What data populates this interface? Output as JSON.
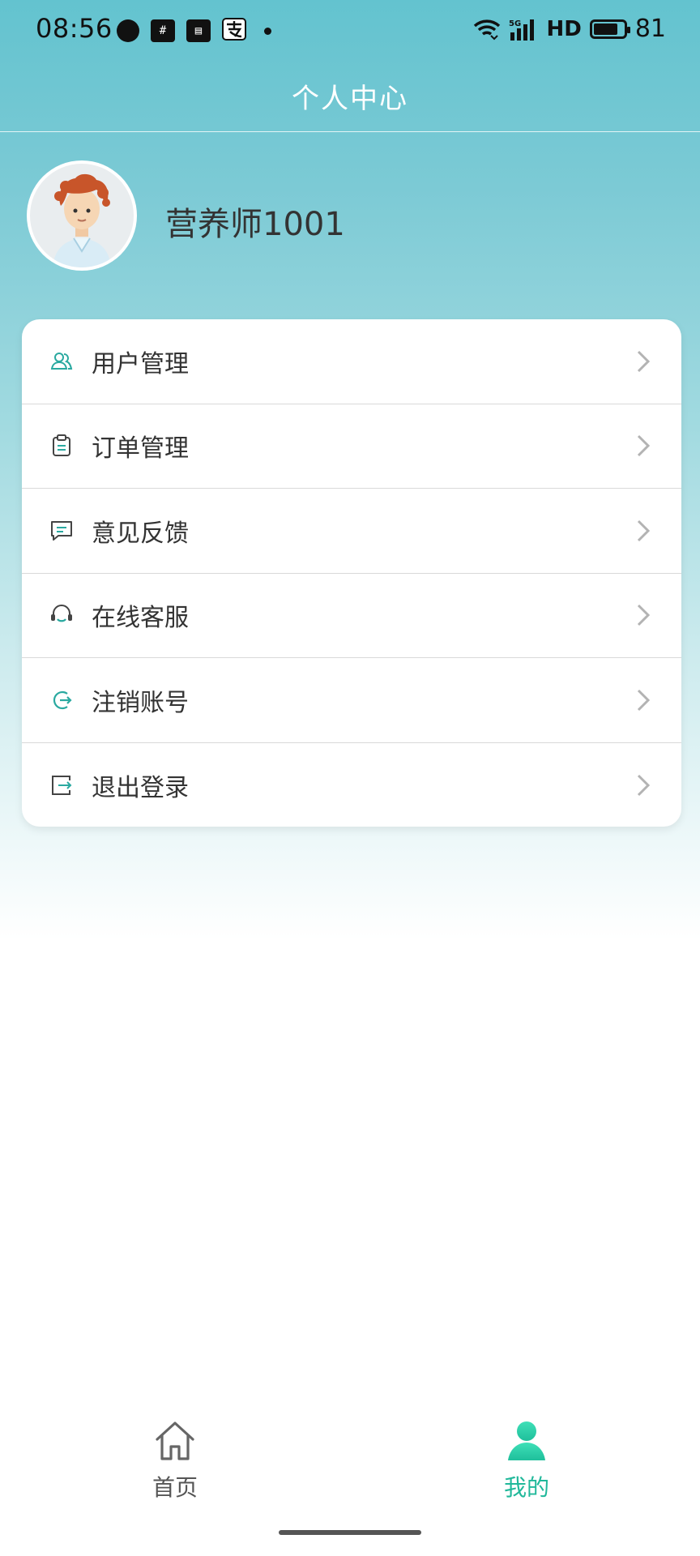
{
  "status_bar": {
    "time": "08:56",
    "network": "HD",
    "signal_label": "5G",
    "battery": "81",
    "left_icons": [
      "chat-bubble-icon",
      "hash-app-icon",
      "card-app-icon",
      "alipay-icon"
    ],
    "battery_level_percent": 81
  },
  "header": {
    "title": "个人中心"
  },
  "profile": {
    "username": "营养师1001",
    "avatar_icon": "avatar-icon"
  },
  "menu": {
    "items": [
      {
        "label": "用户管理",
        "icon": "users-icon"
      },
      {
        "label": "订单管理",
        "icon": "clipboard-icon"
      },
      {
        "label": "意见反馈",
        "icon": "message-icon"
      },
      {
        "label": "在线客服",
        "icon": "headset-icon"
      },
      {
        "label": "注销账号",
        "icon": "logout-circle-icon"
      },
      {
        "label": "退出登录",
        "icon": "exit-icon"
      }
    ]
  },
  "bottom_nav": {
    "home_label": "首页",
    "mine_label": "我的",
    "active": "mine"
  },
  "colors": {
    "accent": "#20b89a",
    "header_top": "#63c3cf",
    "icon_teal": "#2aa9a0",
    "text": "#333333"
  }
}
